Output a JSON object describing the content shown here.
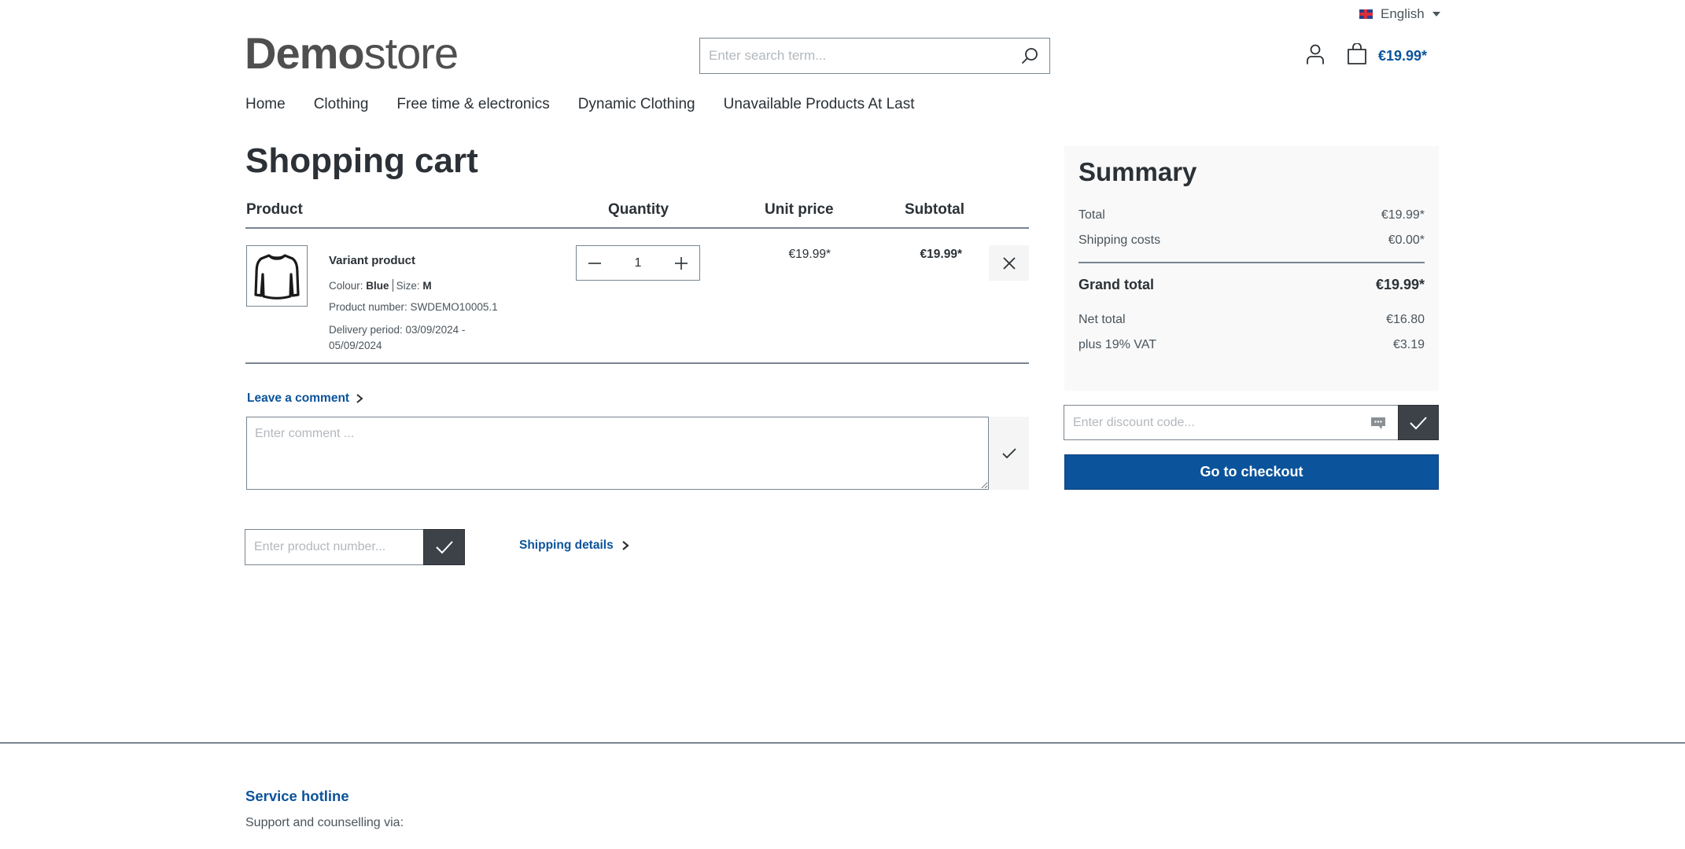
{
  "topbar": {
    "language": "English",
    "flag": "uk-flag-icon"
  },
  "header": {
    "logo_bold": "Demo",
    "logo_light": "store",
    "search_placeholder": "Enter search term...",
    "cart_total": "€19.99*"
  },
  "nav": {
    "items": [
      {
        "label": "Home"
      },
      {
        "label": "Clothing"
      },
      {
        "label": "Free time & electronics"
      },
      {
        "label": "Dynamic Clothing"
      },
      {
        "label": "Unavailable Products At Last"
      }
    ]
  },
  "cart": {
    "title": "Shopping cart",
    "columns": {
      "product": "Product",
      "quantity": "Quantity",
      "unit_price": "Unit price",
      "subtotal": "Subtotal"
    },
    "items": [
      {
        "name": "Variant product",
        "colour_label": "Colour:",
        "colour_value": "Blue",
        "size_label": "Size:",
        "size_value": "M",
        "product_number": "Product number: SWDEMO10005.1",
        "delivery_line1": "Delivery period: 03/09/2024 -",
        "delivery_line2": "05/09/2024",
        "quantity": "1",
        "unit_price": "€19.99*",
        "subtotal": "€19.99*",
        "image_icon": "sweater-icon"
      }
    ],
    "comment": {
      "link_label": "Leave a comment",
      "placeholder": "Enter comment ..."
    },
    "product_number_placeholder": "Enter product number...",
    "shipping_details_label": "Shipping details"
  },
  "summary": {
    "title": "Summary",
    "rows": {
      "total": {
        "label": "Total",
        "value": "€19.99*"
      },
      "shipping": {
        "label": "Shipping costs",
        "value": "€0.00*"
      },
      "grand_total": {
        "label": "Grand total",
        "value": "€19.99*"
      },
      "net_total": {
        "label": "Net total",
        "value": "€16.80"
      },
      "vat": {
        "label": "plus 19% VAT",
        "value": "€3.19"
      }
    },
    "discount_placeholder": "Enter discount code...",
    "checkout_label": "Go to checkout"
  },
  "footer": {
    "hotline_title": "Service hotline",
    "support_text": "Support and counselling via:"
  },
  "colors": {
    "brand": "#0b539b",
    "dark_button": "#3c4248",
    "border": "#798490",
    "summary_bg": "#f9f9f9"
  }
}
